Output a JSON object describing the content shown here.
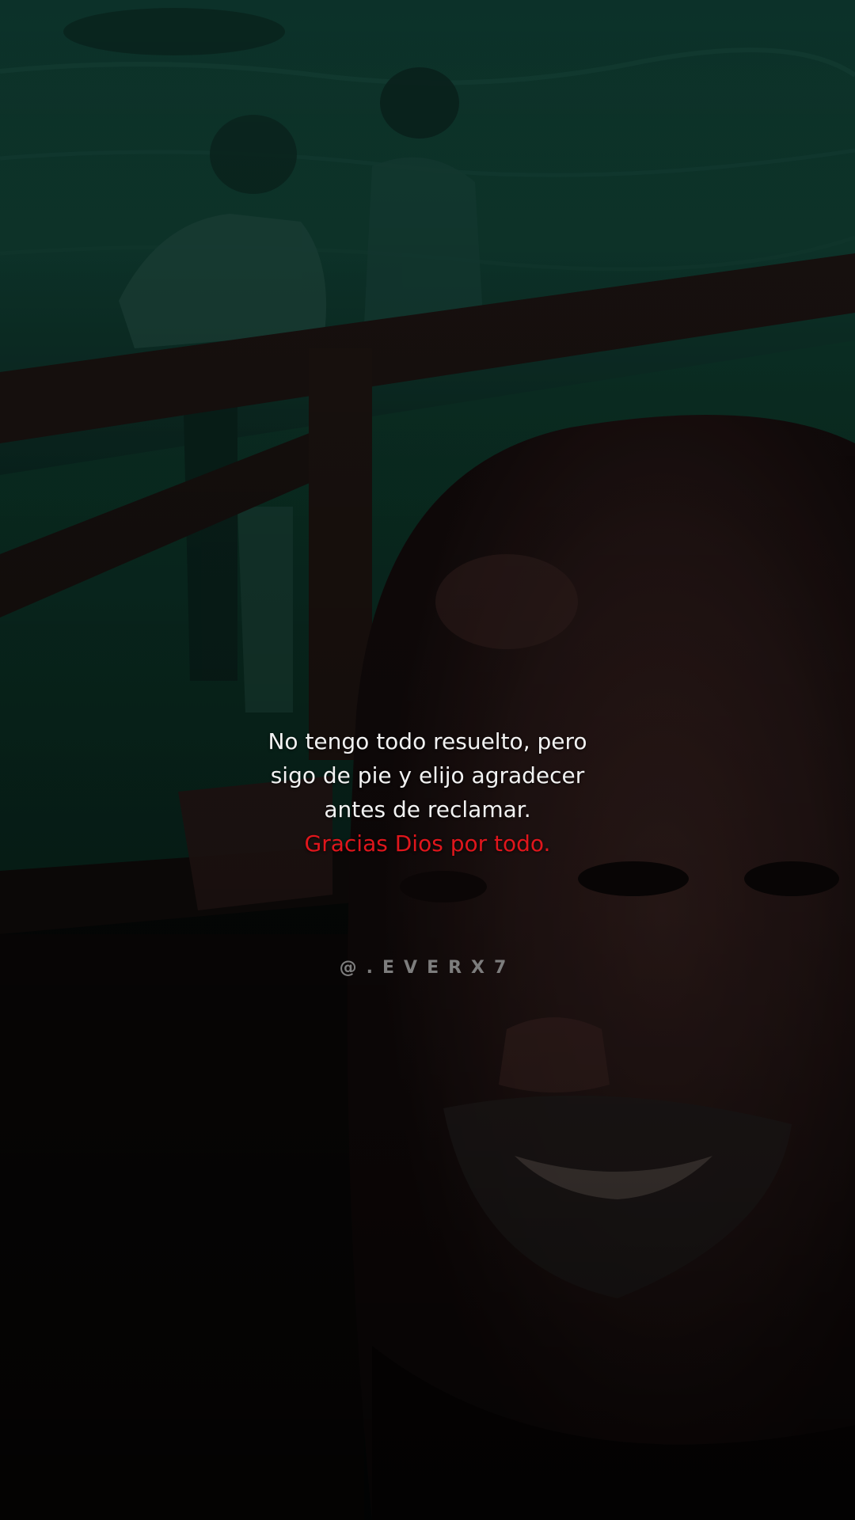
{
  "quote": {
    "line1": "No tengo todo resuelto, pero",
    "line2": "sigo de pie y elijo agradecer",
    "line3": "antes de reclamar.",
    "highlight": "Gracias Dios por todo."
  },
  "handle": "@.EVERX7",
  "colors": {
    "text": "#f2f2f2",
    "accent": "#e0161c",
    "handle": "#7d7d7d",
    "tint": "#0f3b30"
  }
}
